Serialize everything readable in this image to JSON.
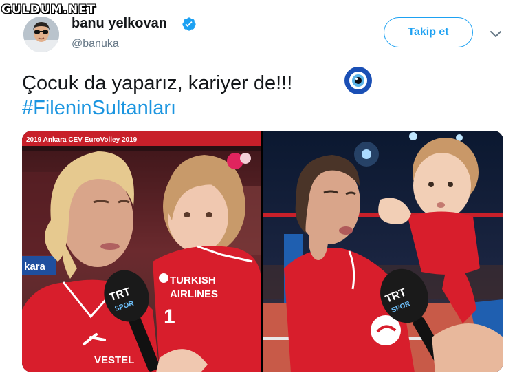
{
  "watermark": "GULDUM.NET",
  "profile": {
    "display_name": "banu yelkovan",
    "handle": "@banuka"
  },
  "actions": {
    "follow_label": "Takip et"
  },
  "tweet": {
    "text": "Çocuk da yaparız, kariyer de!!!",
    "hashtag": "#FileninSultanları"
  },
  "photo_left": {
    "banner_text": "2019 Ankara CEV EuroVolley 2019",
    "side_text": "kara",
    "jersey_text_1": "TURKISH",
    "jersey_text_2": "AIRLINES",
    "jersey_number": "1",
    "sponsor_text": "VESTEL",
    "mic_text_1": "TRT",
    "mic_text_2": "SPOR"
  },
  "photo_right": {
    "mic_text_1": "TRT",
    "mic_text_2": "SPOR"
  },
  "colors": {
    "accent": "#1da1f2",
    "hashtag": "#1b95e0",
    "jersey_red": "#d81e2c"
  }
}
